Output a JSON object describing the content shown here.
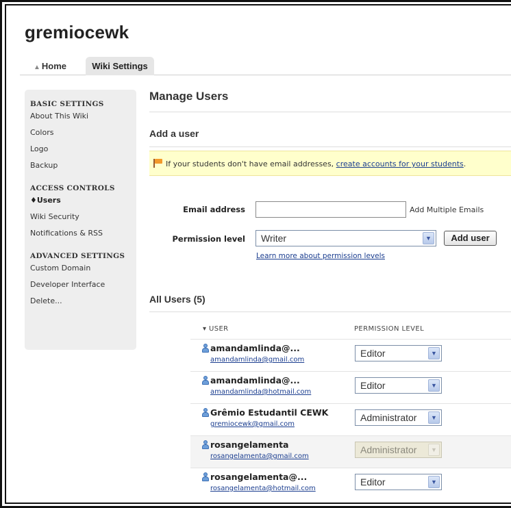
{
  "site": {
    "title": "gremiocewk"
  },
  "tabs": [
    {
      "label": "Home",
      "icon": "home-icon"
    },
    {
      "label": "Wiki Settings",
      "active": true
    }
  ],
  "sidebar": {
    "groups": [
      {
        "heading": "BASIC SETTINGS",
        "items": [
          "About This Wiki",
          "Colors",
          "Logo",
          "Backup"
        ]
      },
      {
        "heading": "ACCESS CONTROLS",
        "items": [
          "♦Users",
          "Wiki Security",
          "Notifications & RSS"
        ],
        "active_index": 0
      },
      {
        "heading": "ADVANCED SETTINGS",
        "items": [
          "Custom Domain",
          "Developer Interface",
          "Delete..."
        ]
      }
    ]
  },
  "main": {
    "title": "Manage Users",
    "add_user": {
      "heading": "Add a user",
      "notice_prefix": "If your students don't have email addresses, ",
      "notice_link": "create accounts for your students",
      "notice_suffix": ".",
      "email_label": "Email address",
      "email_value": "",
      "add_multiple": "Add Multiple Emails",
      "permission_label": "Permission level",
      "permission_value": "Writer",
      "add_button": "Add user",
      "learn_more": "Learn more about permission levels"
    },
    "all_users": {
      "heading": "All Users (5)",
      "col_user": "▾ USER",
      "col_permission": "PERMISSION LEVEL",
      "rows": [
        {
          "name": "amandamlinda@...",
          "email": "amandamlinda@gmail.com",
          "permission": "Editor",
          "disabled": false
        },
        {
          "name": "amandamlinda@...",
          "email": "amandamlinda@hotmail.com",
          "permission": "Editor",
          "disabled": false
        },
        {
          "name": "Grêmio Estudantil CEWK",
          "email": "gremiocewk@gmail.com",
          "permission": "Administrator",
          "disabled": false
        },
        {
          "name": "rosangelamenta",
          "email": "rosangelamenta@gmail.com",
          "permission": "Administrator",
          "disabled": true
        },
        {
          "name": "rosangelamenta@...",
          "email": "rosangelamenta@hotmail.com",
          "permission": "Editor",
          "disabled": false
        }
      ]
    }
  },
  "colors": {
    "link": "#1a3d8f",
    "notice_bg": "#ffffcc",
    "sidebar_bg": "#eeeeee"
  }
}
